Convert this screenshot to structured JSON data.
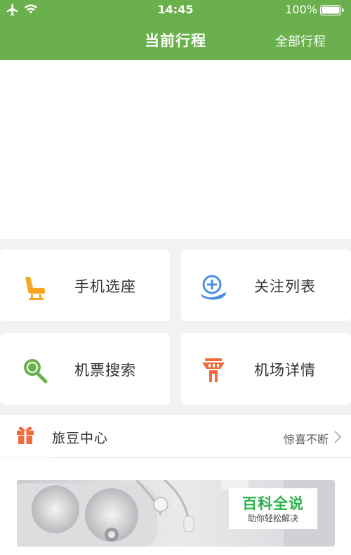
{
  "status_bar": {
    "time": "14:45",
    "battery": "100%"
  },
  "header": {
    "title": "当前行程",
    "right_action": "全部行程"
  },
  "menu_tiles": [
    {
      "label": "手机选座",
      "icon": "seat-icon",
      "color": "#f5a623"
    },
    {
      "label": "关注列表",
      "icon": "follow-flight-icon",
      "color": "#4a90e2"
    },
    {
      "label": "机票搜索",
      "icon": "search-icon",
      "color": "#6ab04c"
    },
    {
      "label": "机场详情",
      "icon": "control-tower-icon",
      "color": "#f26b3a"
    }
  ],
  "lvdou": {
    "label": "旅豆中心",
    "subtitle": "惊喜不断",
    "icon": "gift-icon"
  },
  "watermark": {
    "title": "百科全说",
    "subtitle": "助你轻松解决"
  },
  "colors": {
    "brand_green": "#6ab04c",
    "background": "#f2f2f2"
  }
}
